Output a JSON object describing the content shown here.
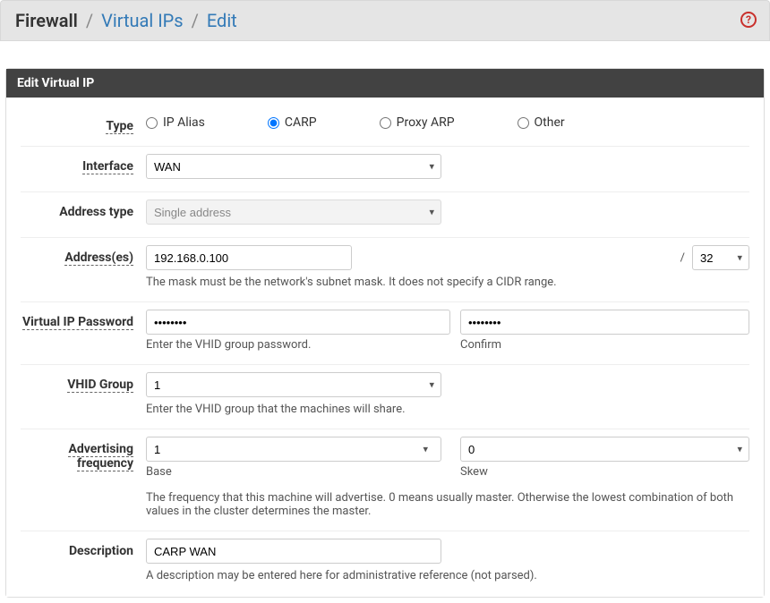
{
  "breadcrumb": {
    "root": "Firewall",
    "mid": "Virtual IPs",
    "leaf": "Edit"
  },
  "panel_title": "Edit Virtual IP",
  "labels": {
    "type": "Type",
    "interface": "Interface",
    "address_type": "Address type",
    "addresses": "Address(es)",
    "vip_password": "Virtual IP Password",
    "vhid_group": "VHID Group",
    "adv_freq_1": "Advertising",
    "adv_freq_2": "frequency",
    "description": "Description"
  },
  "type_options": {
    "ip_alias": "IP Alias",
    "carp": "CARP",
    "proxy_arp": "Proxy ARP",
    "other": "Other"
  },
  "type_selected": "carp",
  "interface_value": "WAN",
  "address_type_value": "Single address",
  "address_value": "192.168.0.100",
  "mask_value": "32",
  "help": {
    "address": "The mask must be the network's subnet mask. It does not specify a CIDR range.",
    "password": "Enter the VHID group password.",
    "password_confirm": "Confirm",
    "vhid": "Enter the VHID group that the machines will share.",
    "adv_base": "Base",
    "adv_skew": "Skew",
    "adv_full": "The frequency that this machine will advertise. 0 means usually master. Otherwise the lowest combination of both values in the cluster determines the master.",
    "description": "A description may be entered here for administrative reference (not parsed)."
  },
  "password_value": "••••••••",
  "password_confirm_value": "••••••••",
  "vhid_value": "1",
  "adv_base_value": "1",
  "adv_skew_value": "0",
  "description_value": "CARP WAN",
  "slash": "/"
}
